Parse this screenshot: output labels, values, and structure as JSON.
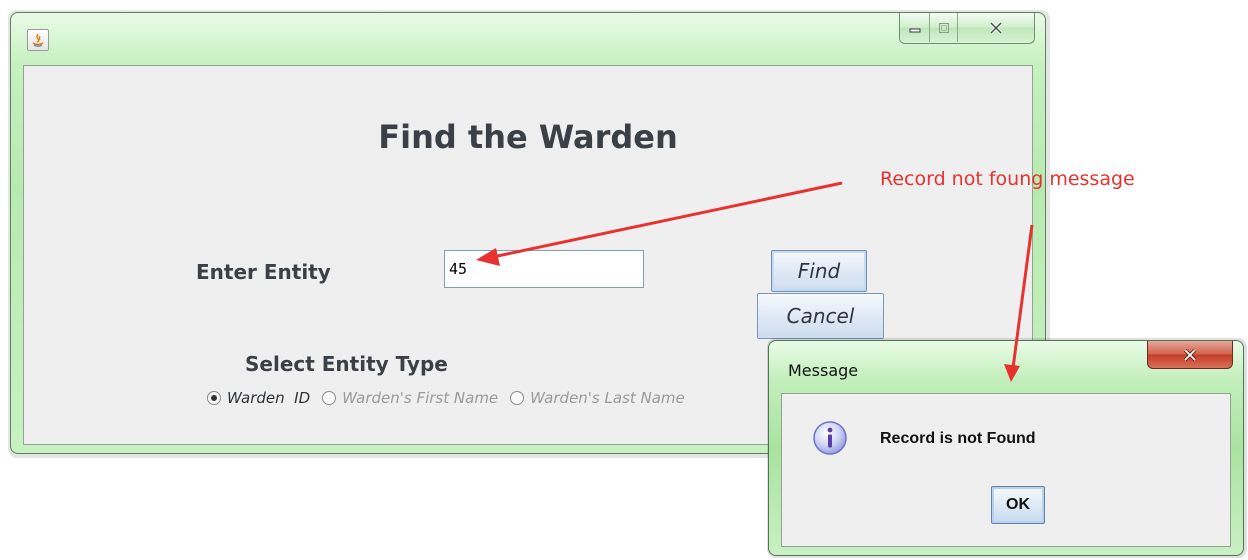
{
  "main_window": {
    "title": "",
    "heading": "Find the Warden",
    "entity_label": "Enter Entity",
    "entity_value": "45",
    "find_label": "Find",
    "cancel_label": "Cancel",
    "select_type_label": "Select Entity Type",
    "radio_options": [
      {
        "label": "Warden  ID",
        "selected": true
      },
      {
        "label": "Warden's First Name",
        "selected": false
      },
      {
        "label": "Warden's Last Name",
        "selected": false
      }
    ]
  },
  "annotation": {
    "text": "Record not foung message",
    "color": "#e8322f"
  },
  "message_dialog": {
    "title": "Message",
    "text": "Record is not Found",
    "ok_label": "OK",
    "icon": "info-icon"
  },
  "icons": {
    "app_icon": "java-icon",
    "minimize": "minimize-icon",
    "maximize": "maximize-icon",
    "close": "close-icon"
  }
}
